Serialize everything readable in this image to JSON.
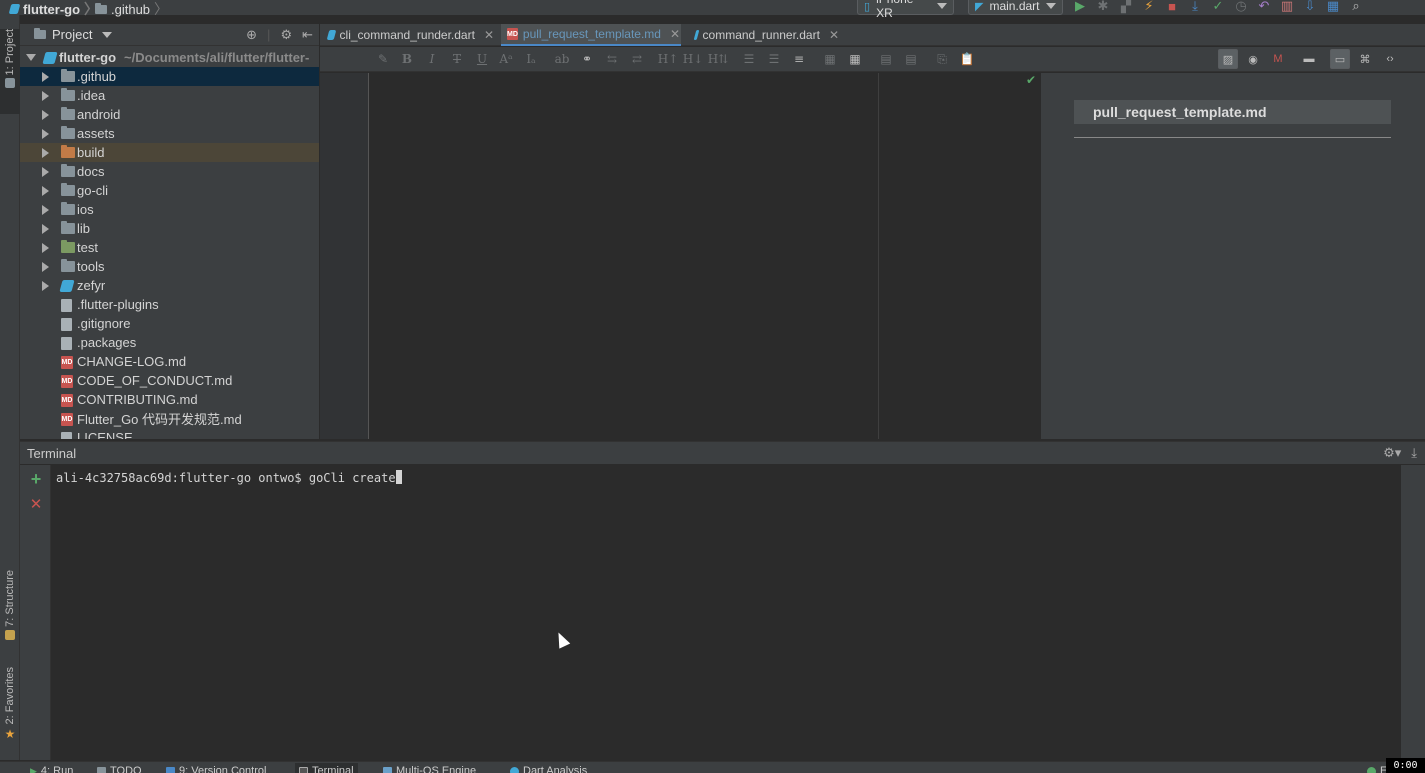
{
  "navbar": {
    "project_root": "flutter-go",
    "current_folder": ".github",
    "device": "iPhone XR",
    "run_config": "main.dart"
  },
  "left_strip": {
    "project_tab": "1: Project",
    "structure_tab": "7: Structure",
    "favorites_tab": "2: Favorites"
  },
  "project_panel": {
    "header": "Project",
    "root_name": "flutter-go",
    "root_path": "~/Documents/ali/flutter/flutter-",
    "items": [
      {
        "label": ".github",
        "kind": "folder"
      },
      {
        "label": ".idea",
        "kind": "folder"
      },
      {
        "label": "android",
        "kind": "folder"
      },
      {
        "label": "assets",
        "kind": "folder"
      },
      {
        "label": "build",
        "kind": "folder-excluded"
      },
      {
        "label": "docs",
        "kind": "folder"
      },
      {
        "label": "go-cli",
        "kind": "folder"
      },
      {
        "label": "ios",
        "kind": "folder"
      },
      {
        "label": "lib",
        "kind": "folder"
      },
      {
        "label": "test",
        "kind": "folder-test"
      },
      {
        "label": "tools",
        "kind": "folder"
      },
      {
        "label": "zefyr",
        "kind": "folder-dart"
      },
      {
        "label": ".flutter-plugins",
        "kind": "file"
      },
      {
        "label": ".gitignore",
        "kind": "file"
      },
      {
        "label": ".packages",
        "kind": "file"
      },
      {
        "label": "CHANGE-LOG.md",
        "kind": "md"
      },
      {
        "label": "CODE_OF_CONDUCT.md",
        "kind": "md"
      },
      {
        "label": "CONTRIBUTING.md",
        "kind": "md"
      },
      {
        "label": "Flutter_Go 代码开发规范.md",
        "kind": "md"
      },
      {
        "label": "LICENSE",
        "kind": "file"
      }
    ]
  },
  "editor_tabs": [
    {
      "label": "cli_command_runder.dart",
      "active": false
    },
    {
      "label": "pull_request_template.md",
      "active": true
    },
    {
      "label": "command_runner.dart",
      "active": false
    }
  ],
  "preview": {
    "title": "pull_request_template.md"
  },
  "terminal": {
    "title": "Terminal",
    "prompt": "ali-4c32758ac69d:flutter-go ontwo$ goCli create"
  },
  "bottom_bar": {
    "tabs": [
      "4: Run",
      "TODO",
      "9: Version Control",
      "Terminal",
      "Multi-OS Engine",
      "Dart Analysis"
    ],
    "event_log": "Event",
    "rec_badge": "0:00"
  },
  "colors": {
    "selection": "#0d293e",
    "accent_blue": "#4a88c7",
    "run_green": "#59a869",
    "stop_red": "#c75450"
  }
}
